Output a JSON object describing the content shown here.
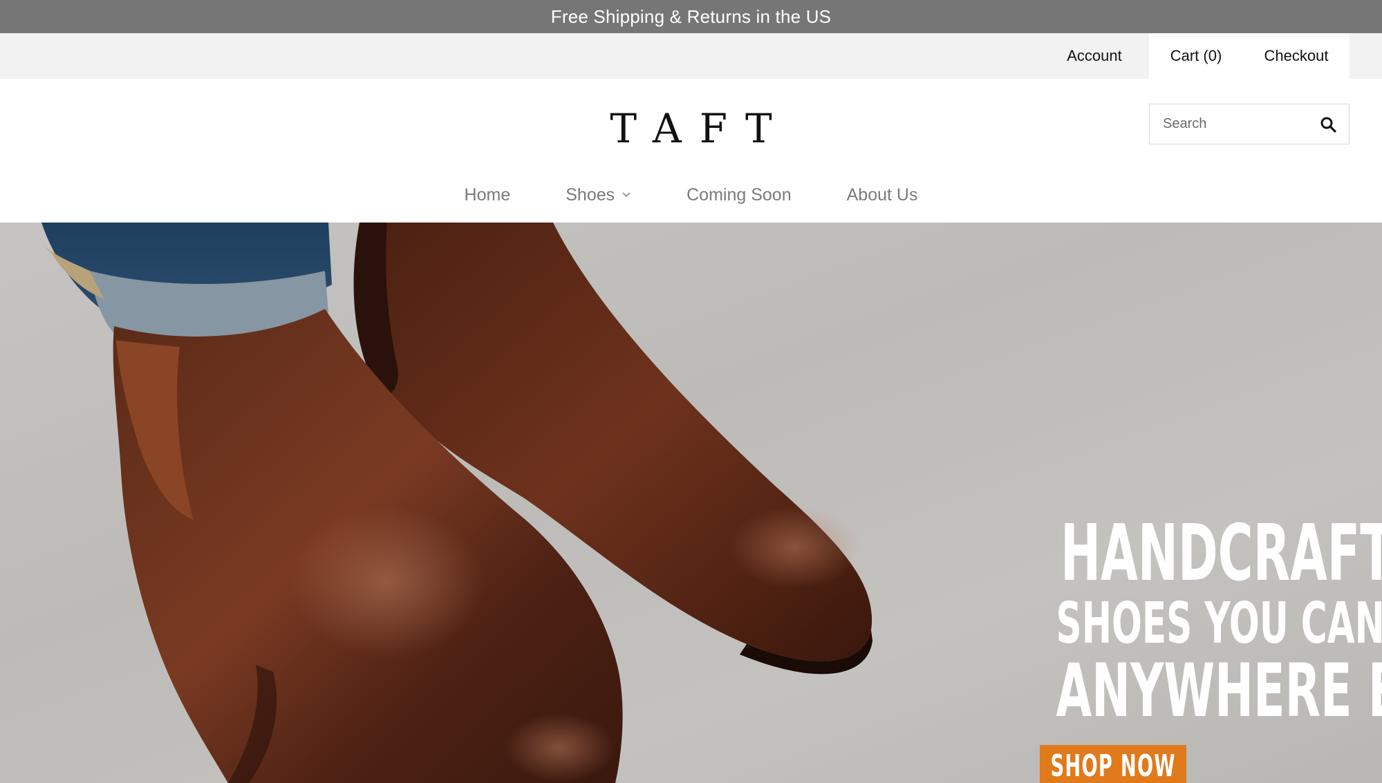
{
  "announcement": {
    "text": "Free Shipping & Returns in the US"
  },
  "utility_nav": {
    "account_label": "Account",
    "cart_label": "Cart (0)",
    "checkout_label": "Checkout"
  },
  "header": {
    "logo_text": "TAFT",
    "search": {
      "placeholder": "Search",
      "value": ""
    },
    "nav": [
      {
        "label": "Home"
      },
      {
        "label": "Shoes",
        "has_dropdown": true
      },
      {
        "label": "Coming Soon"
      },
      {
        "label": "About Us"
      }
    ]
  },
  "hero": {
    "line1": "HANDCRAFTED",
    "line2": "SHOES YOU CAN’T FIND",
    "line3": "ANYWHERE ELSE",
    "cta_label": "SHOP NOW"
  },
  "colors": {
    "announcement_bg": "#767676",
    "utility_bg": "#f2f2f2",
    "cta_bg": "#e07a1b",
    "nav_text": "#7a7a7a"
  },
  "icons": [
    "search-icon",
    "chevron-down-icon"
  ]
}
